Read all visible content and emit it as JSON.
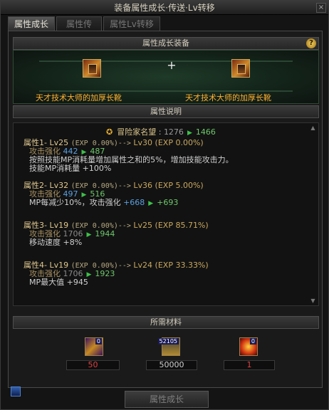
{
  "window": {
    "title": "装备属性成长·传送·Lv转移",
    "close": "×"
  },
  "tabs": [
    "属性成长",
    "属性传送",
    "属性Lv转移"
  ],
  "equip_section": {
    "title": "属性成长装备",
    "help": "?",
    "left_item": "天才技术大师的加厚长靴",
    "plus": "+",
    "right_item": "天才技术大师的加厚长靴"
  },
  "desc_section": {
    "title": "属性说明",
    "fame": {
      "label": "冒险家名望",
      "old": "1276",
      "new": "1466"
    },
    "attrs": [
      {
        "head": "属性1- Lv25",
        "exp": "(EXP 0.00%)-->",
        "next": "Lv30 (EXP 0.00%)",
        "lines": [
          {
            "k": "攻击强化",
            "old": "442",
            "new": "487"
          },
          {
            "text": "按照技能MP消耗量增加属性之和的5%，增加技能攻击力。"
          },
          {
            "text": "技能MP消耗量 +100%"
          }
        ]
      },
      {
        "head": "属性2- Lv32",
        "exp": "(EXP 0.00%)-->",
        "next": "Lv36 (EXP 5.00%)",
        "lines": [
          {
            "k": "攻击强化",
            "old": "497",
            "new": "516"
          },
          {
            "text": "MP每减少10%，攻击强化",
            "old": "+668",
            "new": "+693"
          }
        ]
      },
      {
        "head": "属性3- Lv19",
        "exp": "(EXP 0.00%)-->",
        "next": "Lv25 (EXP 85.71%)",
        "lines": [
          {
            "k": "攻击强化",
            "old": "1706",
            "new": "1944"
          },
          {
            "text": "移动速度 +8%"
          }
        ]
      },
      {
        "head": "属性4- Lv19",
        "exp": "(EXP 0.00%)-->",
        "next": "Lv24 (EXP 33.33%)",
        "lines": [
          {
            "k": "攻击强化",
            "old": "1706",
            "new": "1923"
          },
          {
            "text": "MP最大值 +945"
          }
        ]
      }
    ]
  },
  "materials_section": {
    "title": "所需材料",
    "items": [
      {
        "icon": "crystal-icon",
        "badge": "0",
        "qty": "50"
      },
      {
        "icon": "coin-icon",
        "badge": "52105",
        "qty": "50000"
      },
      {
        "icon": "orb-icon",
        "badge": "0",
        "qty": "1"
      }
    ]
  },
  "action_button": "属性成长",
  "colors": {
    "item_name": "#ffb030",
    "new_value": "#6ec86a",
    "arrow": "#3ec04a",
    "missing_qty": "#e04040"
  }
}
